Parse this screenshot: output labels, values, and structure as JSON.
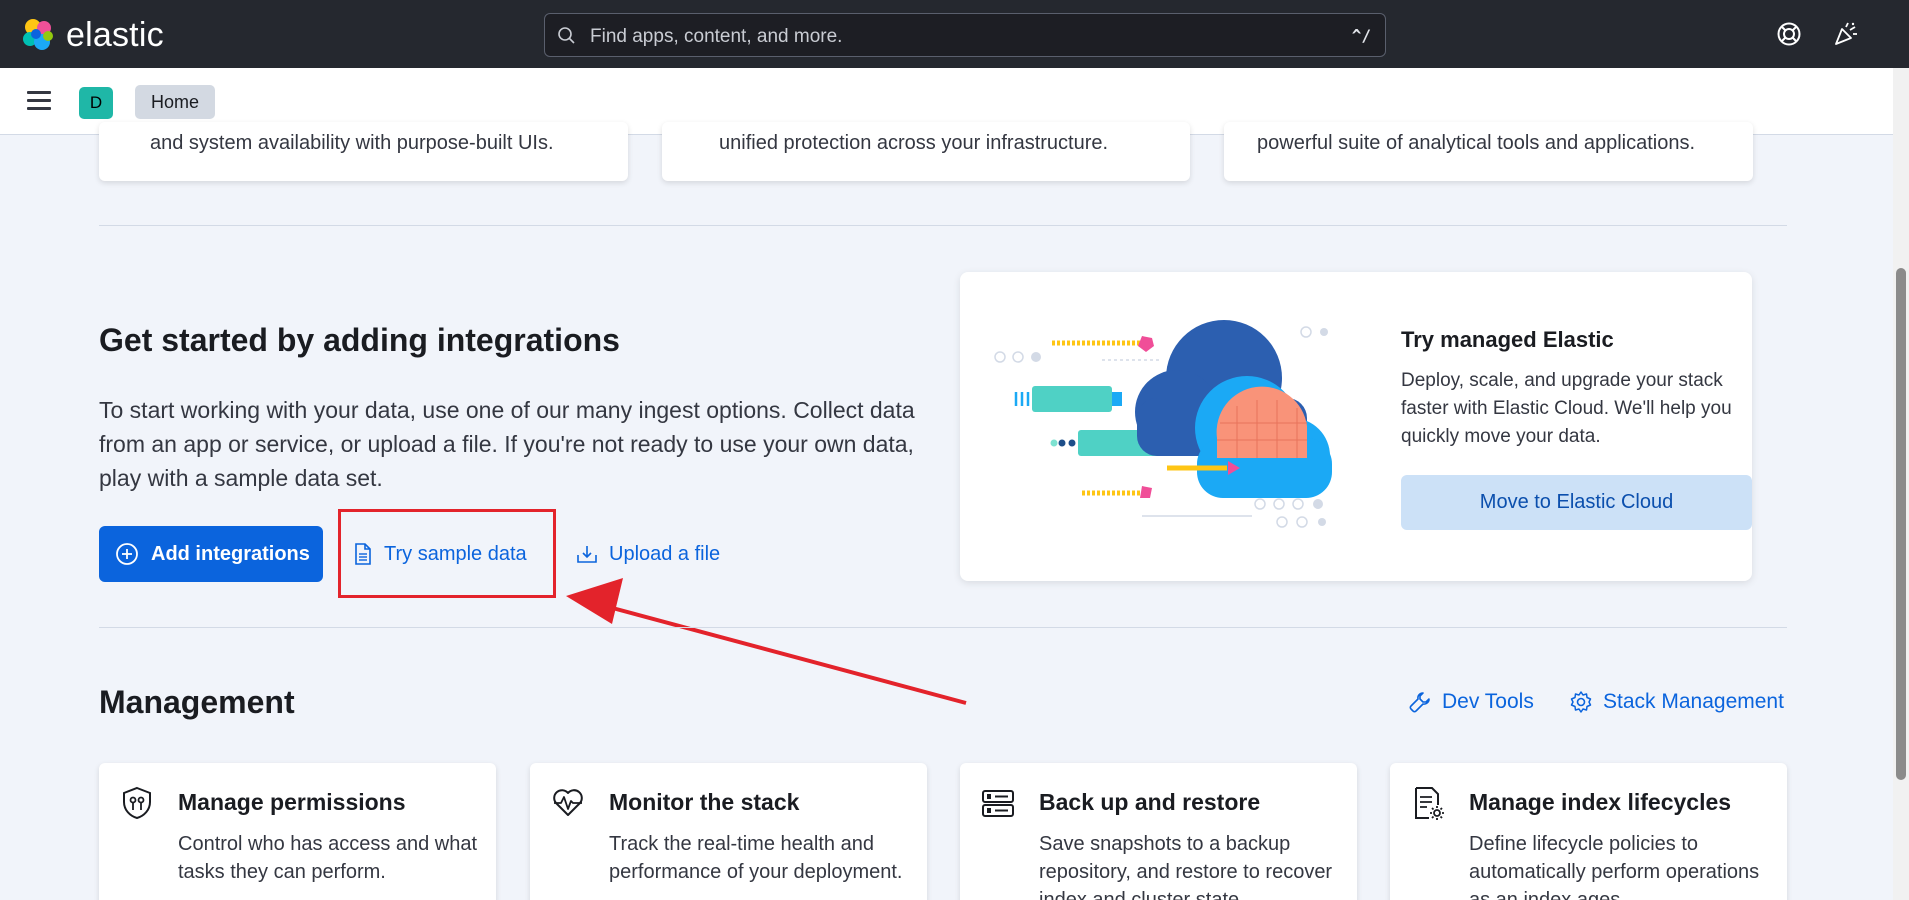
{
  "header": {
    "logo_text": "elastic",
    "search_placeholder": "Find apps, content, and more.",
    "search_shortcut": "^/",
    "icons": [
      "help-icon",
      "news-feed-icon"
    ]
  },
  "subnav": {
    "space_initial": "D",
    "breadcrumb": "Home"
  },
  "solution_cards": [
    {
      "text": "and system availability with purpose-built UIs."
    },
    {
      "text": "unified protection across your infrastructure."
    },
    {
      "text": "powerful suite of analytical tools and applications."
    }
  ],
  "integrations": {
    "title": "Get started by adding integrations",
    "description": "To start working with your data, use one of our many ingest options. Collect data from an app or service, or upload a file. If you're not ready to use your own data, play with a sample data set.",
    "add_button": "Add integrations",
    "sample_button": "Try sample data",
    "upload_button": "Upload a file"
  },
  "cloud_promo": {
    "title": "Try managed Elastic",
    "description": "Deploy, scale, and upgrade your stack faster with Elastic Cloud. We'll help you quickly move your data.",
    "button": "Move to Elastic Cloud"
  },
  "management": {
    "title": "Management",
    "dev_tools": "Dev Tools",
    "stack_management": "Stack Management",
    "cards": [
      {
        "title": "Manage permissions",
        "description": "Control who has access and what tasks they can perform.",
        "icon": "shield-icon"
      },
      {
        "title": "Monitor the stack",
        "description": "Track the real-time health and performance of your deployment.",
        "icon": "heartbeat-icon"
      },
      {
        "title": "Back up and restore",
        "description": "Save snapshots to a backup repository, and restore to recover index and cluster state.",
        "icon": "storage-icon"
      },
      {
        "title": "Manage index lifecycles",
        "description": "Define lifecycle policies to automatically perform operations as an index ages.",
        "icon": "document-gear-icon"
      }
    ]
  },
  "colors": {
    "header_bg": "#25282f",
    "primary": "#0b64dd",
    "highlight": "#e3232b"
  }
}
